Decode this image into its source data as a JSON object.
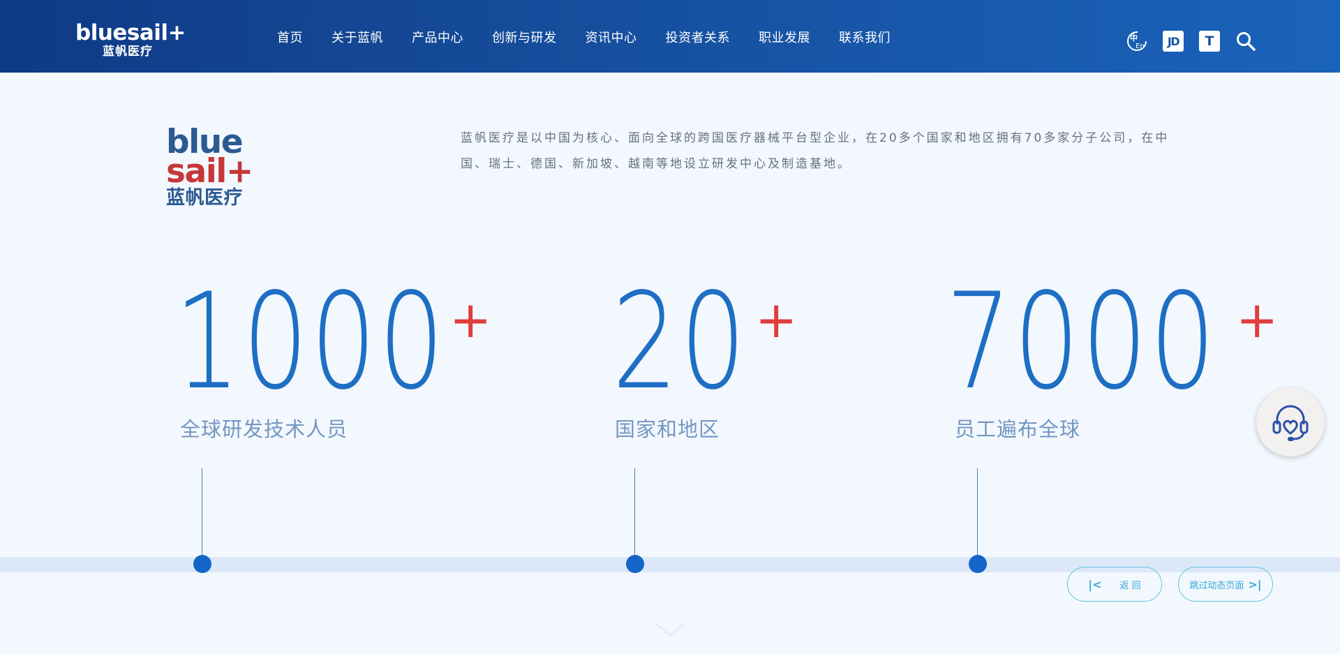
{
  "header": {
    "logo_en": "bluesail+",
    "logo_cn": "蓝帆医疗",
    "nav": [
      "首页",
      "关于蓝帆",
      "产品中心",
      "创新与研发",
      "资讯中心",
      "投资者关系",
      "职业发展",
      "联系我们"
    ],
    "tools": {
      "lang_icon": "language-cn-en-icon",
      "jd_label": "JD",
      "tmall_label": "T",
      "search_icon": "search-icon"
    }
  },
  "intro": {
    "logo_line1": "blue",
    "logo_line2": "sail+",
    "logo_line3": "蓝帆医疗",
    "text": "蓝帆医疗是以中国为核心、面向全球的跨国医疗器械平台型企业，在20多个国家和地区拥有70多家分子公司，在中国、瑞士、德国、新加坡、越南等地设立研发中心及制造基地。"
  },
  "stats": [
    {
      "number": "1000",
      "suffix": "+",
      "label": "全球研发技术人员"
    },
    {
      "number": "20",
      "suffix": "+",
      "label": "国家和地区"
    },
    {
      "number": "7000",
      "suffix": "+",
      "label": "员工遍布全球"
    }
  ],
  "controls": {
    "back_label": "返  回",
    "skip_label": "跳过动态页面"
  },
  "colors": {
    "header_start": "#0f3a85",
    "header_end": "#1a63bb",
    "number_blue": "#1e6fc4",
    "plus_red": "#df3d3d",
    "pill_cyan": "#33a9d6"
  }
}
